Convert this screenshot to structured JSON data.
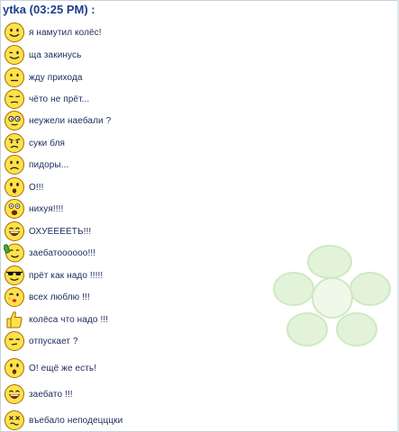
{
  "chat": {
    "sender_header": "ytka (03:25 PM) :",
    "messages": [
      {
        "text": "я намутил колёс!",
        "icon": "smile-icon"
      },
      {
        "text": "ща закинусь",
        "icon": "wink-icon"
      },
      {
        "text": "жду прихода",
        "icon": "waiting-icon"
      },
      {
        "text": "чёто не прёт...",
        "icon": "neutral-icon"
      },
      {
        "text": "неужели наебали ?",
        "icon": "glasses-smiley-icon"
      },
      {
        "text": "суки бля",
        "icon": "angry-icon"
      },
      {
        "text": "пидоры...",
        "icon": "sad-icon"
      },
      {
        "text": "О!!!",
        "icon": "surprised-icon"
      },
      {
        "text": "нихуя!!!!",
        "icon": "shocked-icon"
      },
      {
        "text": "ОХУЕЕЕЕТЬ!!!",
        "icon": "laughing-icon"
      },
      {
        "text": "заебатоооооо!!!",
        "icon": "drinking-icon"
      },
      {
        "text": "прёт как надо !!!!!",
        "icon": "sunglasses-icon"
      },
      {
        "text": "всех люблю !!!",
        "icon": "kiss-icon"
      },
      {
        "text": "колёса что надо !!!",
        "icon": "thumbs-up-icon"
      },
      {
        "text": "отпускает ?",
        "icon": "thinking-icon"
      },
      {
        "text": "О! ещё же есть!",
        "icon": "surprised-icon"
      },
      {
        "text": "заебато !!!",
        "icon": "laughing-icon"
      },
      {
        "text": "въебало неподецццки",
        "icon": "dizzy-icon"
      }
    ]
  },
  "colors": {
    "header_text": "#1e3e8c",
    "message_text": "#1b2a5c",
    "smiley_fill": "#ffe24a",
    "smiley_outline": "#a66a00",
    "watermark": "#d9efcf"
  }
}
